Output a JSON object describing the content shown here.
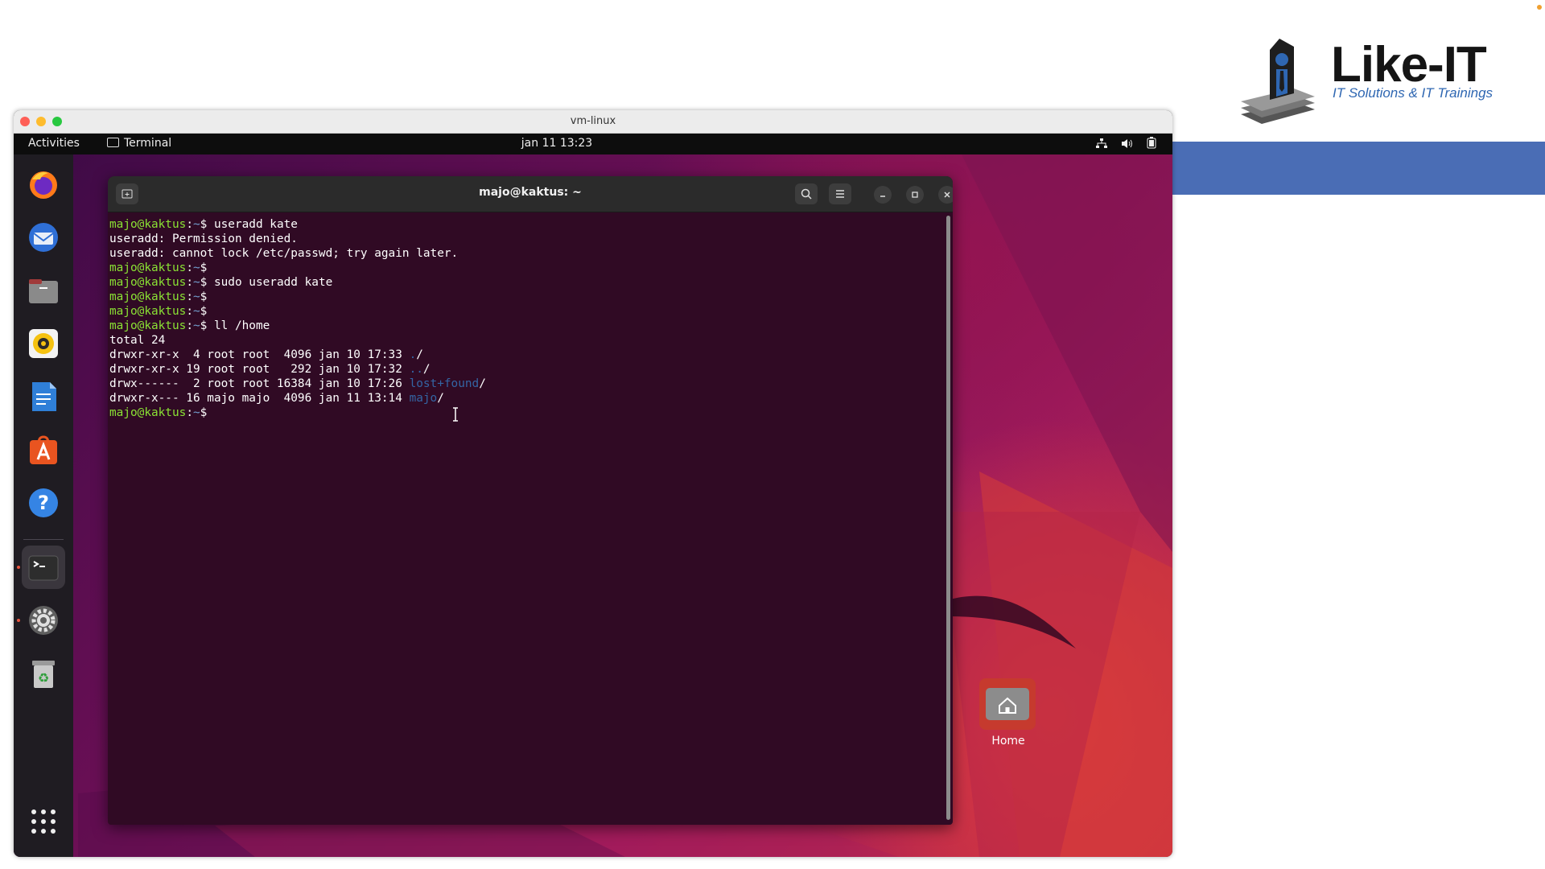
{
  "brand": {
    "name": "Like-IT",
    "tagline": "IT Solutions & IT Trainings",
    "band_color": "#4a6db5"
  },
  "vm_window": {
    "title": "vm-linux"
  },
  "top_bar": {
    "activities": "Activities",
    "app_name": "Terminal",
    "clock": "jan 11  13:23",
    "tray_icons": [
      "network-icon",
      "volume-icon",
      "battery-icon"
    ]
  },
  "dock": {
    "items": [
      "Firefox",
      "Thunderbird",
      "Files",
      "Rhythmbox",
      "LibreOffice Writer",
      "Ubuntu Software",
      "Help",
      "Terminal",
      "Settings",
      "Trash"
    ],
    "show_apps": "show-applications-icon"
  },
  "terminal": {
    "title": "majo@kaktus: ~",
    "prompt_user": "majo@kaktus",
    "prompt_path": "~",
    "lines": [
      {
        "type": "cmd",
        "text": "useradd kate"
      },
      {
        "type": "out",
        "text": "useradd: Permission denied."
      },
      {
        "type": "out",
        "text": "useradd: cannot lock /etc/passwd; try again later."
      },
      {
        "type": "cmd",
        "text": ""
      },
      {
        "type": "cmd",
        "text": "sudo useradd kate"
      },
      {
        "type": "cmd",
        "text": ""
      },
      {
        "type": "cmd",
        "text": ""
      },
      {
        "type": "cmd",
        "text": "ll /home"
      },
      {
        "type": "out",
        "text": "total 24"
      },
      {
        "type": "ls",
        "text": "drwxr-xr-x  4 root root  4096 jan 10 17:33 ",
        "name": "./"
      },
      {
        "type": "ls",
        "text": "drwxr-xr-x 19 root root   292 jan 10 17:32 ",
        "name": "../"
      },
      {
        "type": "ls",
        "text": "drwx------  2 root root 16384 jan 10 17:26 ",
        "name": "lost+found"
      },
      {
        "type": "ls",
        "text": "drwxr-x--- 16 majo majo  4096 jan 11 13:14 ",
        "name": "majo"
      },
      {
        "type": "cmd",
        "text": ""
      }
    ]
  },
  "desktop": {
    "home_label": "Home"
  },
  "colors": {
    "terminal_bg": "#300a24",
    "prompt_user": "#8ae234",
    "prompt_path": "#729fcf",
    "directory": "#3465a4"
  }
}
